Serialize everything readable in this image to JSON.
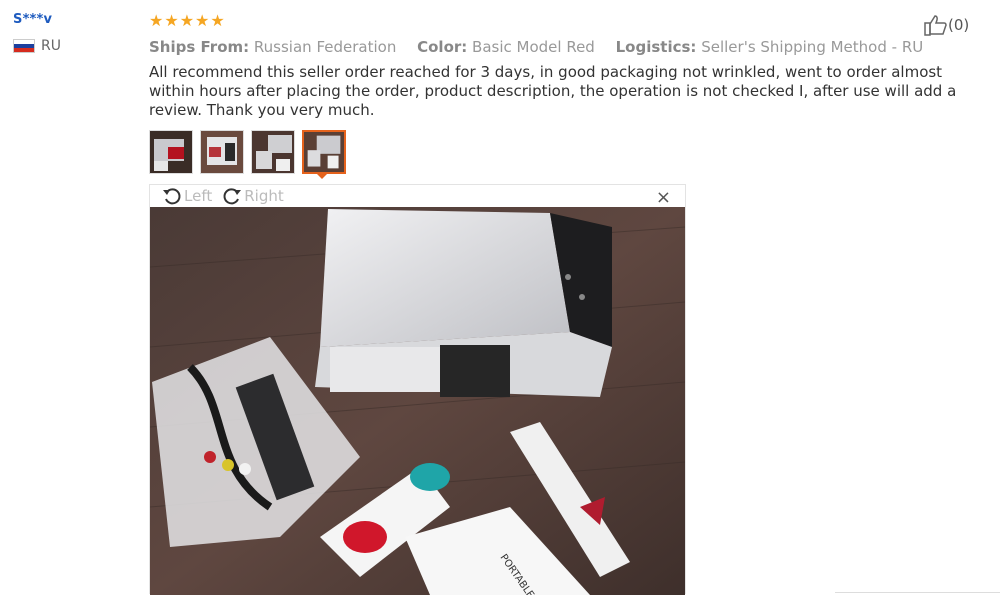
{
  "user": {
    "name": "S***v",
    "country": "RU"
  },
  "review": {
    "stars": 5,
    "ships_from_label": "Ships From:",
    "ships_from": "Russian Federation",
    "color_label": "Color:",
    "color": "Basic Model Red",
    "logistics_label": "Logistics:",
    "logistics": "Seller's Shipping Method - RU",
    "text": "All recommend this seller order reached for 3 days, in good packaging not wrinkled, went to order almost within hours after placing the order, product description, the operation is not checked I, after use will add a review. Thank you very much."
  },
  "viewer": {
    "rotate_left": "Left",
    "rotate_right": "Right",
    "close": "×"
  },
  "like": {
    "count": "(0)"
  },
  "colors": {
    "accent": "#e5621c",
    "star": "#f5a623",
    "username": "#1e5bbf"
  }
}
